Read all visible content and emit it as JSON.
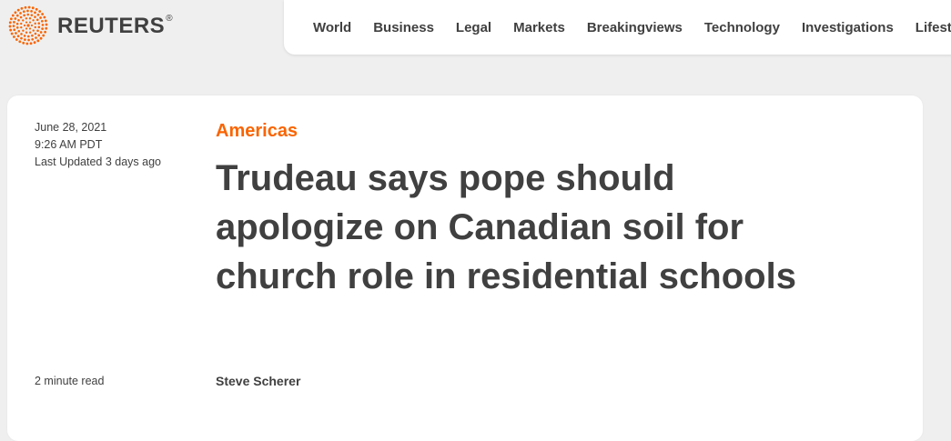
{
  "brand": {
    "name": "REUTERS",
    "registered_mark": "®",
    "accent_color": "#fa6400"
  },
  "nav": {
    "items": [
      {
        "label": "World"
      },
      {
        "label": "Business"
      },
      {
        "label": "Legal"
      },
      {
        "label": "Markets"
      },
      {
        "label": "Breakingviews"
      },
      {
        "label": "Technology"
      },
      {
        "label": "Investigations"
      },
      {
        "label": "Lifestyle"
      }
    ]
  },
  "article": {
    "date": "June 28, 2021",
    "time": "9:26 AM PDT",
    "last_updated": "Last Updated 3 days ago",
    "section": "Americas",
    "headline": "Trudeau says pope should apologize on Canadian soil for church role in residential schools",
    "read_time": "2 minute read",
    "author": "Steve Scherer"
  }
}
